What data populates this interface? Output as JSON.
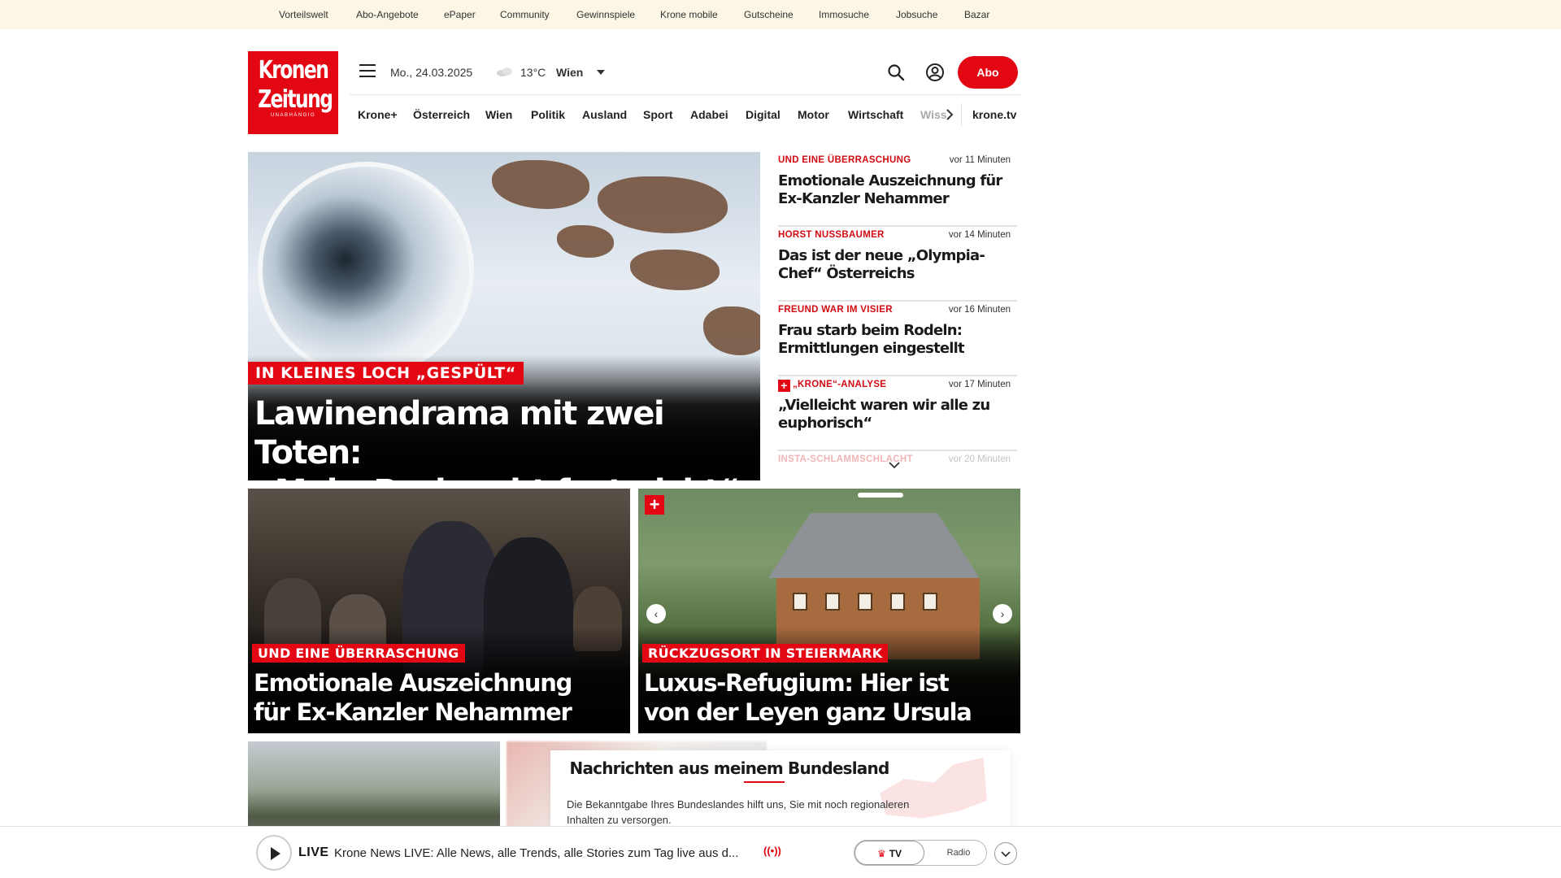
{
  "topbar": {
    "links": [
      "Vorteilswelt",
      "Abo-Angebote",
      "ePaper",
      "Community",
      "Gewinnspiele",
      "Krone mobile",
      "Gutscheine",
      "Immosuche",
      "Jobsuche",
      "Bazar"
    ]
  },
  "logo": {
    "line1": "Kronen",
    "line2": "Zeitung",
    "tagline": "UNABHÄNGIG"
  },
  "header": {
    "date": "Mo., 24.03.2025",
    "weather_icon": "cloud-icon",
    "temperature": "13°C",
    "city": "Wien",
    "abo_label": "Abo"
  },
  "nav": {
    "items": [
      "Krone+",
      "Österreich",
      "Wien",
      "Politik",
      "Ausland",
      "Sport",
      "Adabei",
      "Digital",
      "Motor",
      "Wirtschaft",
      "Wiss"
    ],
    "extra": "krone.tv"
  },
  "hero": {
    "kicker": "IN KLEINES LOCH „GESPÜLT“",
    "title_line1": "Lawinendrama mit zwei Toten:",
    "title_line2": "„Mehr Pech geht fast nicht“"
  },
  "ticker": {
    "items": [
      {
        "kicker": "UND EINE ÜBERRASCHUNG",
        "time": "vor 11 Minuten",
        "title": "Emotionale Auszeichnung für Ex-Kanzler Nehammer"
      },
      {
        "kicker": "HORST NUSSBAUMER",
        "time": "vor 14 Minuten",
        "title": "Das ist der neue „Olympia-Chef“ Österreichs"
      },
      {
        "kicker": "FREUND WAR IM VISIER",
        "time": "vor 16 Minuten",
        "title": "Frau starb beim Rodeln: Ermittlungen eingestellt"
      },
      {
        "kicker": "„KRONE“-ANALYSE",
        "time": "vor 17 Minuten",
        "title": "„Vielleicht waren wir alle zu euphorisch“"
      },
      {
        "kicker": "INSTA-SCHLAMMSCHLACHT",
        "time": "vor 20 Minuten",
        "title": ""
      }
    ]
  },
  "cards": [
    {
      "kicker": "UND EINE ÜBERRASCHUNG",
      "title_line1": "Emotionale Auszeichnung",
      "title_line2": "für Ex-Kanzler Nehammer"
    },
    {
      "kicker": "RÜCKZUGSORT IN STEIERMARK",
      "title_line1": "Luxus-Refugium: Hier ist",
      "title_line2": "von der Leyen ganz Ursula"
    }
  ],
  "bundesland": {
    "title": "Nachrichten aus meinem Bundesland",
    "text_line1": "Die Bekanntgabe Ihres Bundeslandes hilft uns, Sie mit noch regionaleren",
    "text_line2": "Inhalten zu versorgen."
  },
  "live": {
    "label": "LIVE",
    "text": "Krone News LIVE: Alle News, alle Trends, alle Stories zum Tag live aus d...",
    "radio_waves": "((•))",
    "tv_label": "TV",
    "radio_label": "Radio"
  },
  "colors": {
    "brand_red": "#e30613",
    "topbar_bg": "#fbf6e5"
  }
}
